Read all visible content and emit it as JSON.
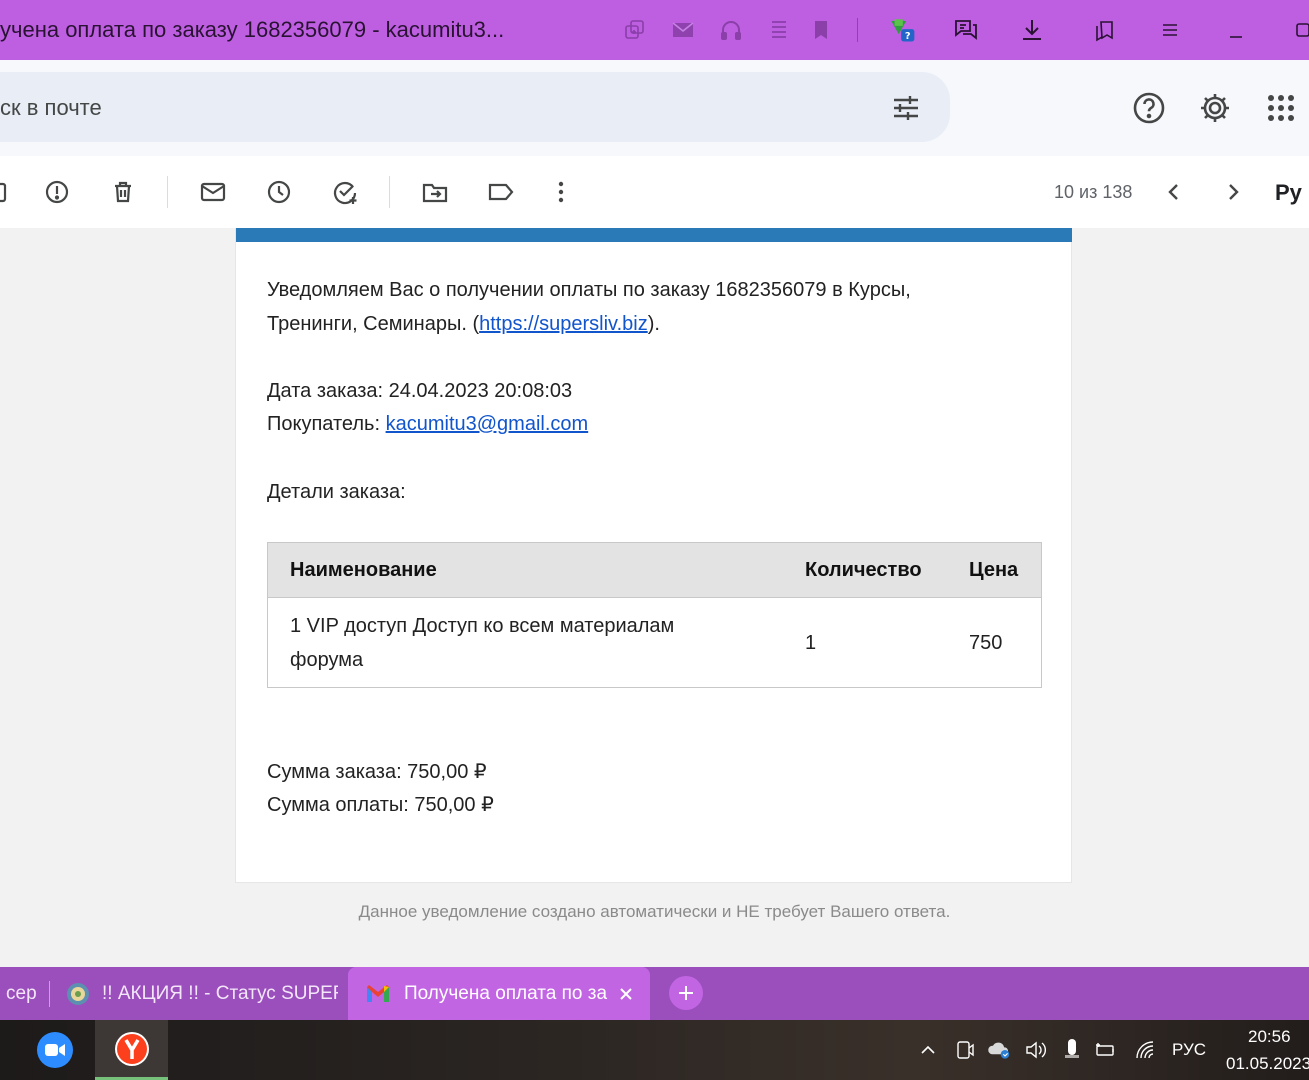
{
  "window": {
    "title": "учена оплата по заказу 1682356079 - kacumitu3..."
  },
  "search": {
    "placeholder": "ск в почте"
  },
  "toolbar": {
    "counter": "10 из 138",
    "lang": "Ру"
  },
  "email": {
    "intro_line1": "Уведомляем Вас о получении оплаты по заказу 1682356079 в Курсы,",
    "intro_line2_prefix": "Тренинги, Семинары. (",
    "intro_link": "https://supersliv.biz",
    "intro_line2_suffix": ").",
    "order_date_label": "Дата заказа: 24.04.2023 20:08:03",
    "buyer_label": "Покупатель: ",
    "buyer_email": "kacumitu3@gmail.com",
    "details_label": "Детали заказа:",
    "table": {
      "headers": [
        "Наименование",
        "Количество",
        "Цена"
      ],
      "rows": [
        {
          "name_line1": "1 VIP доступ Доступ ко всем материалам",
          "name_line2": "форума",
          "qty": "1",
          "price": "750"
        }
      ]
    },
    "order_sum": "Сумма заказа: 750,00 ₽",
    "paid_sum": "Сумма оплаты: 750,00 ₽",
    "footer_note": "Данное уведомление создано автоматически и НЕ требует Вашего ответа."
  },
  "tabs": [
    {
      "label": "сер",
      "active": false
    },
    {
      "label": "!! АКЦИЯ !! - Статус SUPER",
      "active": false
    },
    {
      "label": "Получена оплата по за",
      "active": true
    }
  ],
  "taskbar": {
    "lang": "РУС",
    "time": "20:56",
    "date": "01.05.2023"
  },
  "colors": {
    "browser_accent": "#bd5fe0",
    "email_topbar": "#2a7ab8",
    "link": "#1155cc"
  }
}
